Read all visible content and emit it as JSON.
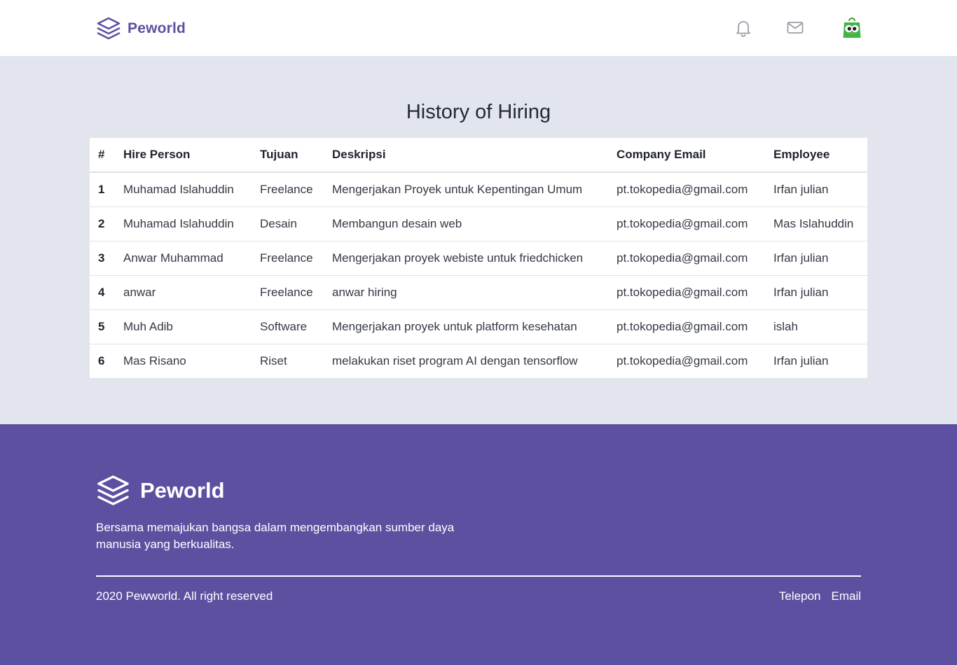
{
  "navbar": {
    "brand": "Peworld",
    "icons": [
      "bell-icon",
      "mail-icon",
      "avatar"
    ]
  },
  "main": {
    "title": "History of Hiring",
    "table": {
      "headers": [
        "#",
        "Hire Person",
        "Tujuan",
        "Deskripsi",
        "Company Email",
        "Employee"
      ],
      "rows": [
        [
          "1",
          "Muhamad Islahuddin",
          "Freelance",
          "Mengerjakan Proyek untuk Kepentingan Umum",
          "pt.tokopedia@gmail.com",
          "Irfan julian"
        ],
        [
          "2",
          "Muhamad Islahuddin",
          "Desain",
          "Membangun desain web",
          "pt.tokopedia@gmail.com",
          "Mas Islahuddin"
        ],
        [
          "3",
          "Anwar Muhammad",
          "Freelance",
          "Mengerjakan proyek webiste untuk friedchicken",
          "pt.tokopedia@gmail.com",
          "Irfan julian"
        ],
        [
          "4",
          "anwar",
          "Freelance",
          "anwar hiring",
          "pt.tokopedia@gmail.com",
          "Irfan julian"
        ],
        [
          "5",
          "Muh Adib",
          "Software",
          "Mengerjakan proyek untuk platform kesehatan",
          "pt.tokopedia@gmail.com",
          "islah"
        ],
        [
          "6",
          "Mas Risano",
          "Riset",
          "melakukan riset program AI dengan tensorflow",
          "pt.tokopedia@gmail.com",
          "Irfan julian"
        ]
      ]
    }
  },
  "footer": {
    "brand": "Peworld",
    "tagline": "Bersama memajukan bangsa dalam mengembangkan sumber daya manusia yang berkualitas.",
    "copyright": "2020 Pewworld. All right reserved",
    "links": [
      "Telepon",
      "Email"
    ]
  },
  "colors": {
    "brand": "#5e50a1",
    "page_bg": "#e2e5ee",
    "surface": "#ffffff"
  }
}
